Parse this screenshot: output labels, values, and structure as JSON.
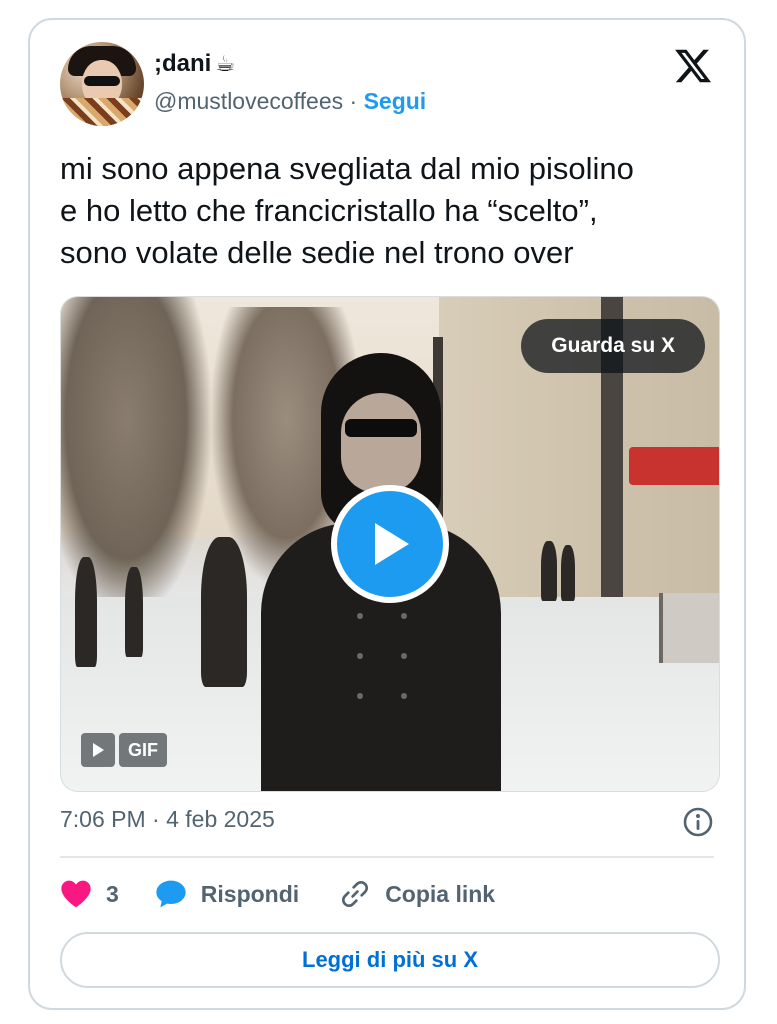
{
  "tweet": {
    "author": {
      "display_name": ";dani",
      "emoji": "☕",
      "handle": "@mustlovecoffees"
    },
    "separator": "·",
    "follow_label": "Segui",
    "text_lines": [
      "mi sono appena svegliata dal mio pisolino",
      "e ho letto che francicristallo ha “scelto”,",
      "sono volate delle sedie nel trono over"
    ],
    "media": {
      "watch_label": "Guarda su X",
      "gif_label": "GIF"
    },
    "timestamp": "7:06 PM · 4 feb 2025",
    "actions": {
      "likes_count": "3",
      "reply_label": "Rispondi",
      "copy_link_label": "Copia link"
    },
    "read_more_label": "Leggi di più su X"
  },
  "colors": {
    "accent": "#1d9bf0",
    "like": "#f91880",
    "text": "#0f1419",
    "muted": "#536471",
    "border": "#cfd9de"
  },
  "icons": {
    "logo": "x-logo-icon",
    "play": "play-icon",
    "like": "heart-icon",
    "reply": "speech-bubble-icon",
    "copy": "link-icon",
    "info": "info-icon"
  }
}
